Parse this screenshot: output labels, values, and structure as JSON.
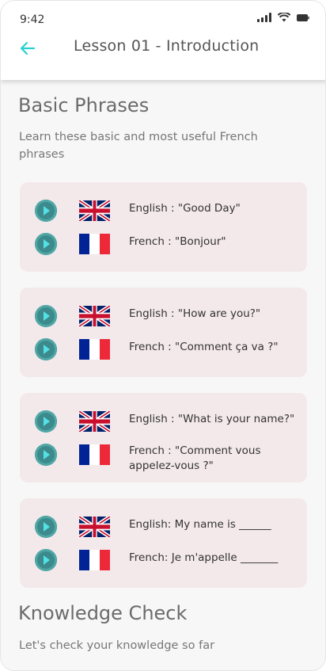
{
  "status_bar": {
    "time": "9:42"
  },
  "header": {
    "title": "Lesson 01 - Introduction"
  },
  "basic_phrases": {
    "title": "Basic Phrases",
    "description": "Learn these basic and most useful French phrases",
    "cards": [
      {
        "english": "English :  \"Good Day\"",
        "french": "French  :  \"Bonjour\""
      },
      {
        "english": "English  :  \"How are you?\"",
        "french": "French  : \"Comment ça va ?\""
      },
      {
        "english": "English  : \"What is your name?\"",
        "french": "French  :  \"Comment vous appelez-vous ?\""
      },
      {
        "english": "English: My name is ______",
        "french": "French: Je m'appelle _______"
      }
    ]
  },
  "knowledge_check": {
    "title": "Knowledge Check",
    "description": "Let's check your knowledge so far"
  },
  "colors": {
    "accent": "#2ad1d3",
    "card_bg": "#f3e9eb",
    "play_button": "#3c8a8c"
  },
  "icons": [
    "back-arrow-icon",
    "signal-icon",
    "wifi-icon",
    "battery-icon",
    "play-icon",
    "uk-flag-icon",
    "france-flag-icon"
  ]
}
